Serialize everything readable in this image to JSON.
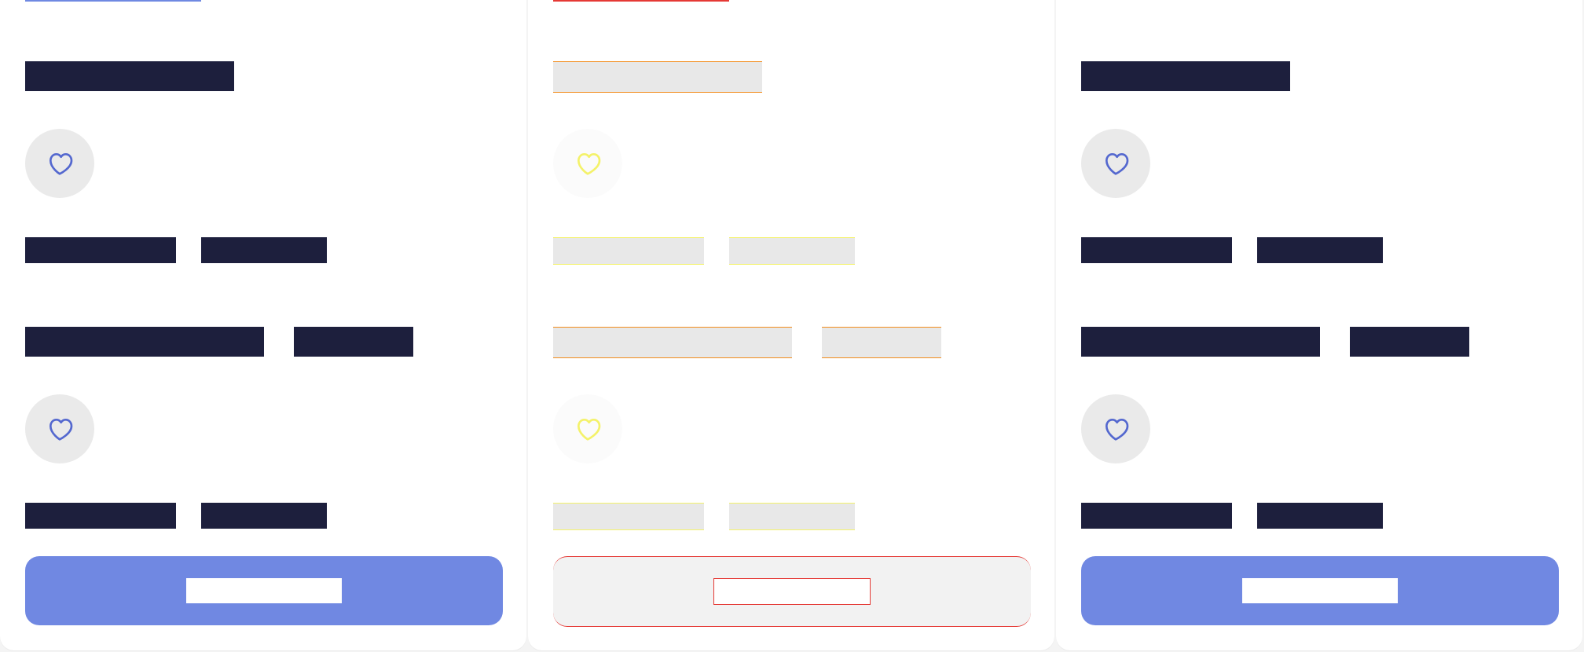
{
  "colors": {
    "ink": "#1d1f3d",
    "accent": "#7088e2",
    "surface": "#ffffff",
    "background": "#f4f4f4",
    "icon_stroke": "#5468cf"
  },
  "cards": [
    {
      "state": "loaded",
      "favorite_icon": "heart-icon",
      "cta_label": ""
    },
    {
      "state": "skeleton",
      "favorite_icon": "heart-icon",
      "cta_label": ""
    },
    {
      "state": "loaded",
      "favorite_icon": "heart-icon",
      "cta_label": ""
    }
  ]
}
